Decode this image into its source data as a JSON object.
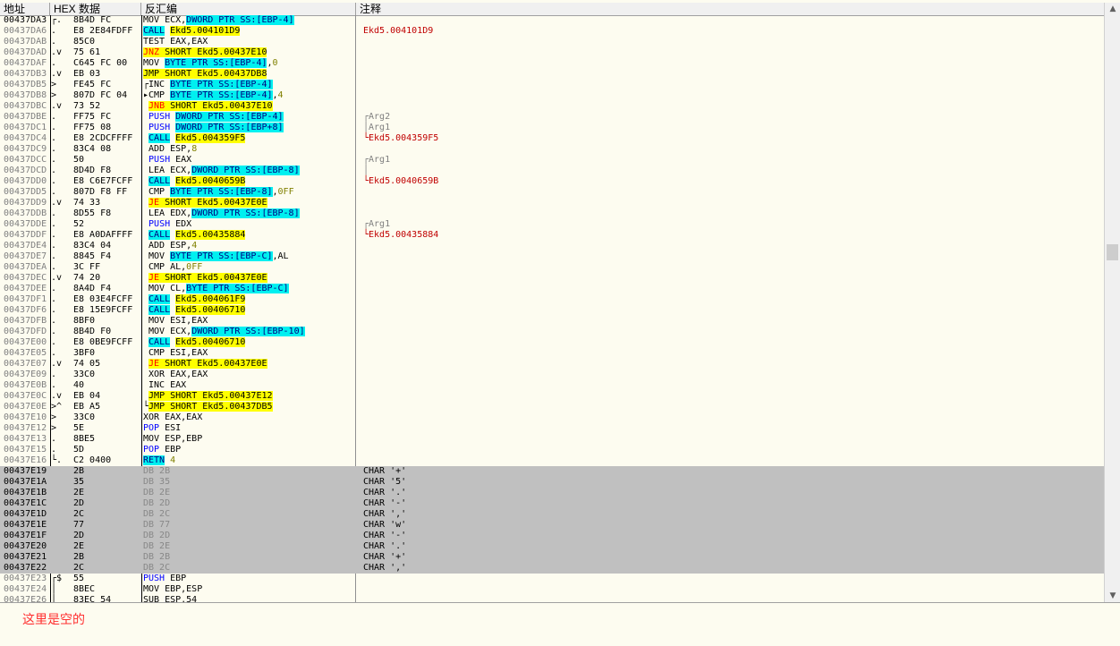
{
  "header": {
    "address": "地址",
    "hex": "HEX 数据",
    "disasm": "反汇编",
    "comment": "注释"
  },
  "rows": [
    {
      "addr": "00437DA3",
      "brk": "┌.",
      "hex": "8B4D FC",
      "dis": [
        [
          "MOV ECX,",
          ""
        ],
        [
          "DWORD PTR SS:[EBP-4]",
          "hl-cy"
        ]
      ],
      "cmt": []
    },
    {
      "addr": "00437DA6",
      "brk": ".",
      "hex": "E8 2E84FDFF",
      "dis": [
        [
          "CALL",
          "hl-cy"
        ],
        [
          " ",
          ""
        ],
        [
          "Ekd5.004101D9",
          "hl-ye"
        ]
      ],
      "cmt": [
        [
          "Ekd5.004101D9",
          "red"
        ]
      ]
    },
    {
      "addr": "00437DAB",
      "brk": ".",
      "hex": "85C0",
      "dis": [
        [
          "TEST EAX,EAX",
          ""
        ]
      ],
      "cmt": []
    },
    {
      "addr": "00437DAD",
      "brk": ".v",
      "hex": "75 61",
      "dis": [
        [
          "JNZ",
          "mn-red"
        ],
        [
          " SHORT Ekd5.00437E10",
          "hl-ye"
        ]
      ],
      "cmt": []
    },
    {
      "addr": "00437DAF",
      "brk": ".",
      "hex": "C645 FC 00",
      "dis": [
        [
          "MOV ",
          ""
        ],
        [
          "BYTE PTR SS:[EBP-4]",
          "hl-cy"
        ],
        [
          ",",
          ""
        ],
        [
          "0",
          "num"
        ]
      ],
      "cmt": []
    },
    {
      "addr": "00437DB3",
      "brk": ".v",
      "hex": "EB 03",
      "dis": [
        [
          "JMP",
          "hl-ye"
        ],
        [
          " SHORT Ekd5.00437DB8",
          "hl-ye"
        ]
      ],
      "cmt": []
    },
    {
      "addr": "00437DB5",
      "brk": ">",
      "hex": "FE45 FC",
      "dis": [
        [
          "┌INC ",
          ""
        ],
        [
          "BYTE PTR SS:[EBP-4]",
          "hl-cy"
        ]
      ],
      "cmt": []
    },
    {
      "addr": "00437DB8",
      "brk": ">",
      "hex": "807D FC 04",
      "dis": [
        [
          "▸CMP ",
          ""
        ],
        [
          "BYTE PTR SS:[EBP-4]",
          "hl-cy"
        ],
        [
          ",",
          ""
        ],
        [
          "4",
          "num"
        ]
      ],
      "cmt": []
    },
    {
      "addr": "00437DBC",
      "brk": ".v",
      "hex": "73 52",
      "dis": [
        [
          " ",
          ""
        ],
        [
          "JNB",
          "mn-red"
        ],
        [
          " SHORT Ekd5.00437E10",
          "hl-ye"
        ]
      ],
      "cmt": []
    },
    {
      "addr": "00437DBE",
      "brk": ".",
      "hex": "FF75 FC",
      "dis": [
        [
          " ",
          ""
        ],
        [
          "PUSH",
          "kw-blue"
        ],
        [
          " ",
          ""
        ],
        [
          "DWORD PTR SS:[EBP-4]",
          "hl-cy"
        ]
      ],
      "cmt": [
        [
          "┌Arg2",
          "grey-t"
        ]
      ]
    },
    {
      "addr": "00437DC1",
      "brk": ".",
      "hex": "FF75 08",
      "dis": [
        [
          " ",
          ""
        ],
        [
          "PUSH",
          "kw-blue"
        ],
        [
          " ",
          ""
        ],
        [
          "DWORD PTR SS:[EBP+8]",
          "hl-cy"
        ]
      ],
      "cmt": [
        [
          "│Arg1",
          "grey-t"
        ]
      ]
    },
    {
      "addr": "00437DC4",
      "brk": ".",
      "hex": "E8 2CDCFFFF",
      "dis": [
        [
          " ",
          ""
        ],
        [
          "CALL",
          "hl-cy"
        ],
        [
          " ",
          ""
        ],
        [
          "Ekd5.004359F5",
          "hl-ye"
        ]
      ],
      "cmt": [
        [
          "└Ekd5.004359F5",
          "red"
        ]
      ]
    },
    {
      "addr": "00437DC9",
      "brk": ".",
      "hex": "83C4 08",
      "dis": [
        [
          " ADD ESP,",
          ""
        ],
        [
          "8",
          "num"
        ]
      ],
      "cmt": []
    },
    {
      "addr": "00437DCC",
      "brk": ".",
      "hex": "50",
      "dis": [
        [
          " ",
          ""
        ],
        [
          "PUSH",
          "kw-blue"
        ],
        [
          " EAX",
          ""
        ]
      ],
      "cmt": [
        [
          "┌Arg1",
          "grey-t"
        ]
      ]
    },
    {
      "addr": "00437DCD",
      "brk": ".",
      "hex": "8D4D F8",
      "dis": [
        [
          " LEA ECX,",
          ""
        ],
        [
          "DWORD PTR SS:[EBP-8]",
          "hl-cy"
        ]
      ],
      "cmt": [
        [
          "│",
          "grey-t"
        ]
      ]
    },
    {
      "addr": "00437DD0",
      "brk": ".",
      "hex": "E8 C6E7FCFF",
      "dis": [
        [
          " ",
          ""
        ],
        [
          "CALL",
          "hl-cy"
        ],
        [
          " ",
          ""
        ],
        [
          "Ekd5.0040659B",
          "hl-ye"
        ]
      ],
      "cmt": [
        [
          "└Ekd5.0040659B",
          "red"
        ]
      ]
    },
    {
      "addr": "00437DD5",
      "brk": ".",
      "hex": "807D F8 FF",
      "dis": [
        [
          " CMP ",
          ""
        ],
        [
          "BYTE PTR SS:[EBP-8]",
          "hl-cy"
        ],
        [
          ",",
          ""
        ],
        [
          "0FF",
          "num"
        ]
      ],
      "cmt": []
    },
    {
      "addr": "00437DD9",
      "brk": ".v",
      "hex": "74 33",
      "dis": [
        [
          " ",
          ""
        ],
        [
          "JE",
          "mn-red"
        ],
        [
          " SHORT Ekd5.00437E0E",
          "hl-ye"
        ]
      ],
      "cmt": []
    },
    {
      "addr": "00437DDB",
      "brk": ".",
      "hex": "8D55 F8",
      "dis": [
        [
          " LEA EDX,",
          ""
        ],
        [
          "DWORD PTR SS:[EBP-8]",
          "hl-cy"
        ]
      ],
      "cmt": []
    },
    {
      "addr": "00437DDE",
      "brk": ".",
      "hex": "52",
      "dis": [
        [
          " ",
          ""
        ],
        [
          "PUSH",
          "kw-blue"
        ],
        [
          " EDX",
          ""
        ]
      ],
      "cmt": [
        [
          "┌Arg1",
          "grey-t"
        ]
      ]
    },
    {
      "addr": "00437DDF",
      "brk": ".",
      "hex": "E8 A0DAFFFF",
      "dis": [
        [
          " ",
          ""
        ],
        [
          "CALL",
          "hl-cy"
        ],
        [
          " ",
          ""
        ],
        [
          "Ekd5.00435884",
          "hl-ye"
        ]
      ],
      "cmt": [
        [
          "└Ekd5.00435884",
          "red"
        ]
      ]
    },
    {
      "addr": "00437DE4",
      "brk": ".",
      "hex": "83C4 04",
      "dis": [
        [
          " ADD ESP,",
          ""
        ],
        [
          "4",
          "num"
        ]
      ],
      "cmt": []
    },
    {
      "addr": "00437DE7",
      "brk": ".",
      "hex": "8845 F4",
      "dis": [
        [
          " MOV ",
          ""
        ],
        [
          "BYTE PTR SS:[EBP-C]",
          "hl-cy"
        ],
        [
          ",AL",
          ""
        ]
      ],
      "cmt": []
    },
    {
      "addr": "00437DEA",
      "brk": ".",
      "hex": "3C FF",
      "dis": [
        [
          " CMP AL,",
          ""
        ],
        [
          "0FF",
          "num"
        ]
      ],
      "cmt": []
    },
    {
      "addr": "00437DEC",
      "brk": ".v",
      "hex": "74 20",
      "dis": [
        [
          " ",
          ""
        ],
        [
          "JE",
          "mn-red"
        ],
        [
          " SHORT Ekd5.00437E0E",
          "hl-ye"
        ]
      ],
      "cmt": []
    },
    {
      "addr": "00437DEE",
      "brk": ".",
      "hex": "8A4D F4",
      "dis": [
        [
          " MOV CL,",
          ""
        ],
        [
          "BYTE PTR SS:[EBP-C]",
          "hl-cy"
        ]
      ],
      "cmt": []
    },
    {
      "addr": "00437DF1",
      "brk": ".",
      "hex": "E8 03E4FCFF",
      "dis": [
        [
          " ",
          ""
        ],
        [
          "CALL",
          "hl-cy"
        ],
        [
          " ",
          ""
        ],
        [
          "Ekd5.004061F9",
          "hl-ye"
        ]
      ],
      "cmt": []
    },
    {
      "addr": "00437DF6",
      "brk": ".",
      "hex": "E8 15E9FCFF",
      "dis": [
        [
          " ",
          ""
        ],
        [
          "CALL",
          "hl-cy"
        ],
        [
          " ",
          ""
        ],
        [
          "Ekd5.00406710",
          "hl-ye"
        ]
      ],
      "cmt": []
    },
    {
      "addr": "00437DFB",
      "brk": ".",
      "hex": "8BF0",
      "dis": [
        [
          " MOV ESI,EAX",
          ""
        ]
      ],
      "cmt": []
    },
    {
      "addr": "00437DFD",
      "brk": ".",
      "hex": "8B4D F0",
      "dis": [
        [
          " MOV ECX,",
          ""
        ],
        [
          "DWORD PTR SS:[EBP-10]",
          "hl-cy"
        ]
      ],
      "cmt": []
    },
    {
      "addr": "00437E00",
      "brk": ".",
      "hex": "E8 0BE9FCFF",
      "dis": [
        [
          " ",
          ""
        ],
        [
          "CALL",
          "hl-cy"
        ],
        [
          " ",
          ""
        ],
        [
          "Ekd5.00406710",
          "hl-ye"
        ]
      ],
      "cmt": []
    },
    {
      "addr": "00437E05",
      "brk": ".",
      "hex": "3BF0",
      "dis": [
        [
          " CMP ESI,EAX",
          ""
        ]
      ],
      "cmt": []
    },
    {
      "addr": "00437E07",
      "brk": ".v",
      "hex": "74 05",
      "dis": [
        [
          " ",
          ""
        ],
        [
          "JE",
          "mn-red"
        ],
        [
          " SHORT Ekd5.00437E0E",
          "hl-ye"
        ]
      ],
      "cmt": []
    },
    {
      "addr": "00437E09",
      "brk": ".",
      "hex": "33C0",
      "dis": [
        [
          " XOR EAX,EAX",
          ""
        ]
      ],
      "cmt": []
    },
    {
      "addr": "00437E0B",
      "brk": ".",
      "hex": "40",
      "dis": [
        [
          " INC EAX",
          ""
        ]
      ],
      "cmt": []
    },
    {
      "addr": "00437E0C",
      "brk": ".v",
      "hex": "EB 04",
      "dis": [
        [
          " ",
          ""
        ],
        [
          "JMP",
          "hl-ye"
        ],
        [
          " SHORT Ekd5.00437E12",
          "hl-ye"
        ]
      ],
      "cmt": []
    },
    {
      "addr": "00437E0E",
      "brk": ">^",
      "hex": "EB A5",
      "dis": [
        [
          "└",
          ""
        ],
        [
          "JMP",
          "hl-ye"
        ],
        [
          " SHORT Ekd5.00437DB5",
          "hl-ye"
        ]
      ],
      "cmt": []
    },
    {
      "addr": "00437E10",
      "brk": ">",
      "hex": "33C0",
      "dis": [
        [
          "XOR EAX,EAX",
          ""
        ]
      ],
      "cmt": []
    },
    {
      "addr": "00437E12",
      "brk": ">",
      "hex": "5E",
      "dis": [
        [
          "POP",
          "kw-blue"
        ],
        [
          " ESI",
          ""
        ]
      ],
      "cmt": []
    },
    {
      "addr": "00437E13",
      "brk": ".",
      "hex": "8BE5",
      "dis": [
        [
          "MOV ESP,EBP",
          ""
        ]
      ],
      "cmt": []
    },
    {
      "addr": "00437E15",
      "brk": ".",
      "hex": "5D",
      "dis": [
        [
          "POP",
          "kw-blue"
        ],
        [
          " EBP",
          ""
        ]
      ],
      "cmt": []
    },
    {
      "addr": "00437E16",
      "brk": "└.",
      "hex": "C2 0400",
      "dis": [
        [
          "RETN",
          "hl-cy"
        ],
        [
          " ",
          ""
        ],
        [
          "4",
          "num"
        ]
      ],
      "cmt": []
    },
    {
      "addr": "00437E19",
      "brk": "",
      "hex": "2B",
      "dis": [
        [
          "DB 2B",
          ""
        ]
      ],
      "cmt": [
        [
          "CHAR '+'",
          ""
        ]
      ],
      "grey": true
    },
    {
      "addr": "00437E1A",
      "brk": "",
      "hex": "35",
      "dis": [
        [
          "DB 35",
          ""
        ]
      ],
      "cmt": [
        [
          "CHAR '5'",
          ""
        ]
      ],
      "grey": true
    },
    {
      "addr": "00437E1B",
      "brk": "",
      "hex": "2E",
      "dis": [
        [
          "DB 2E",
          ""
        ]
      ],
      "cmt": [
        [
          "CHAR '.'",
          ""
        ]
      ],
      "grey": true
    },
    {
      "addr": "00437E1C",
      "brk": "",
      "hex": "2D",
      "dis": [
        [
          "DB 2D",
          ""
        ]
      ],
      "cmt": [
        [
          "CHAR '-'",
          ""
        ]
      ],
      "grey": true
    },
    {
      "addr": "00437E1D",
      "brk": "",
      "hex": "2C",
      "dis": [
        [
          "DB 2C",
          ""
        ]
      ],
      "cmt": [
        [
          "CHAR ','",
          ""
        ]
      ],
      "grey": true
    },
    {
      "addr": "00437E1E",
      "brk": "",
      "hex": "77",
      "dis": [
        [
          "DB 77",
          ""
        ]
      ],
      "cmt": [
        [
          "CHAR 'w'",
          ""
        ]
      ],
      "grey": true
    },
    {
      "addr": "00437E1F",
      "brk": "",
      "hex": "2D",
      "dis": [
        [
          "DB 2D",
          ""
        ]
      ],
      "cmt": [
        [
          "CHAR '-'",
          ""
        ]
      ],
      "grey": true
    },
    {
      "addr": "00437E20",
      "brk": "",
      "hex": "2E",
      "dis": [
        [
          "DB 2E",
          ""
        ]
      ],
      "cmt": [
        [
          "CHAR '.'",
          ""
        ]
      ],
      "grey": true
    },
    {
      "addr": "00437E21",
      "brk": "",
      "hex": "2B",
      "dis": [
        [
          "DB 2B",
          ""
        ]
      ],
      "cmt": [
        [
          "CHAR '+'",
          ""
        ]
      ],
      "grey": true
    },
    {
      "addr": "00437E22",
      "brk": "",
      "hex": "2C",
      "dis": [
        [
          "DB 2C",
          ""
        ]
      ],
      "cmt": [
        [
          "CHAR ','",
          ""
        ]
      ],
      "grey": true
    },
    {
      "addr": "00437E23",
      "brk": "┌$",
      "hex": "55",
      "dis": [
        [
          "PUSH",
          "kw-blue"
        ],
        [
          " EBP",
          ""
        ]
      ],
      "cmt": []
    },
    {
      "addr": "00437E24",
      "brk": "│",
      "hex": "8BEC",
      "dis": [
        [
          "MOV EBP,ESP",
          ""
        ]
      ],
      "cmt": []
    },
    {
      "addr": "00437E26",
      "brk": "│",
      "hex": "83EC 54",
      "dis": [
        [
          "SUB ESP,54",
          ""
        ]
      ],
      "cmt": []
    }
  ],
  "bottom_pane": {
    "text": "这里是空的"
  },
  "colors": {
    "background": "#fdfcf0",
    "selected_rows": "#c0c0c0",
    "operand_highlight": "#00f0f0",
    "call_target_highlight": "#ffff00",
    "jump_text": "#ff0000",
    "comment_call": "#c00000"
  },
  "scrollbar": {
    "up_icon": "up-arrow-icon",
    "down_icon": "down-arrow-icon"
  }
}
